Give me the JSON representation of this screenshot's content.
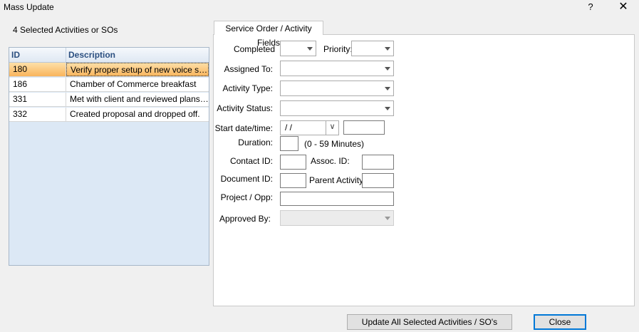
{
  "window": {
    "title": "Mass Update",
    "help_label": "?",
    "close_label": "✕"
  },
  "selection_count_label": "4 Selected Activities or SOs",
  "grid": {
    "columns": [
      "ID",
      "Description"
    ],
    "rows": [
      {
        "id": "180",
        "description": "Verify proper setup of new voice system",
        "selected": true
      },
      {
        "id": "186",
        "description": "Chamber of Commerce breakfast",
        "selected": false
      },
      {
        "id": "331",
        "description": "Met with client and reviewed plans for",
        "selected": false
      },
      {
        "id": "332",
        "description": "Created proposal and dropped off.",
        "selected": false
      }
    ]
  },
  "tab": {
    "label": "Service Order / Activity Fields"
  },
  "form": {
    "completed_label": "Completed",
    "priority_label": "Priority:",
    "assigned_to_label": "Assigned To:",
    "activity_type_label": "Activity Type:",
    "activity_status_label": "Activity Status:",
    "start_datetime_label": "Start date/time:",
    "start_date_value": "/ /",
    "duration_label": "Duration:",
    "duration_hint": "(0 - 59 Minutes)",
    "contact_id_label": "Contact ID:",
    "assoc_id_label": "Assoc.  ID:",
    "document_id_label": "Document ID:",
    "parent_activity_label": "Parent Activity:",
    "project_opp_label": "Project / Opp:",
    "approved_by_label": "Approved By:"
  },
  "buttons": {
    "update_label": "Update All Selected Activities / SO's",
    "close_label": "Close"
  },
  "icons": {
    "dropdown": "chevron-down-icon",
    "close": "close-icon",
    "help": "help-icon"
  }
}
